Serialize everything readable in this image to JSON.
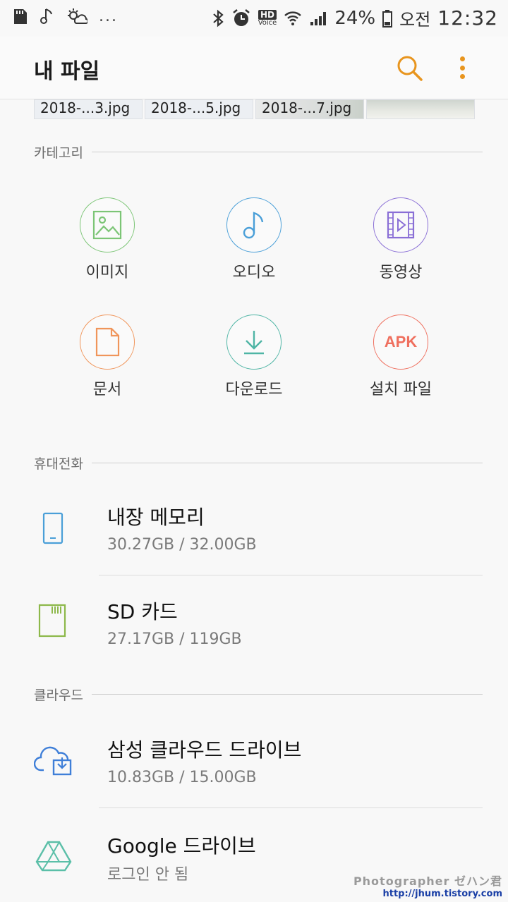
{
  "status_bar": {
    "battery_percent": "24%",
    "ampm": "오전",
    "time": "12:32",
    "hd_label": "HD",
    "voice_label": "Voice",
    "overflow": "..."
  },
  "app_bar": {
    "title": "내 파일"
  },
  "recent_thumbs": [
    "2018-...3.jpg",
    "2018-...5.jpg",
    "2018-...7.jpg",
    ""
  ],
  "sections": {
    "category": "카테고리",
    "phone": "휴대전화",
    "cloud": "클라우드"
  },
  "categories": [
    {
      "label": "이미지",
      "icon": "image-icon",
      "color": "#7cc576"
    },
    {
      "label": "오디오",
      "icon": "music-note-icon",
      "color": "#4a9fd8"
    },
    {
      "label": "동영상",
      "icon": "video-icon",
      "color": "#8a6fd6"
    },
    {
      "label": "문서",
      "icon": "document-icon",
      "color": "#f0955a"
    },
    {
      "label": "다운로드",
      "icon": "download-icon",
      "color": "#4fb5a5"
    },
    {
      "label": "설치 파일",
      "icon": "apk-icon",
      "color": "#ef6f5e",
      "badge": "APK"
    }
  ],
  "storage": [
    {
      "title": "내장 메모리",
      "sub": "30.27GB / 32.00GB",
      "icon": "phone-icon"
    },
    {
      "title": "SD 카드",
      "sub": "27.17GB / 119GB",
      "icon": "sd-card-icon"
    }
  ],
  "cloud": [
    {
      "title": "삼성 클라우드 드라이브",
      "sub": "10.83GB / 15.00GB",
      "icon": "samsung-cloud-icon"
    },
    {
      "title": "Google 드라이브",
      "sub": "로그인 안 됨",
      "icon": "google-drive-icon"
    }
  ],
  "watermark": {
    "line1": "Photographer ゼハン君",
    "line2": "http://jhum.tistory.com"
  }
}
